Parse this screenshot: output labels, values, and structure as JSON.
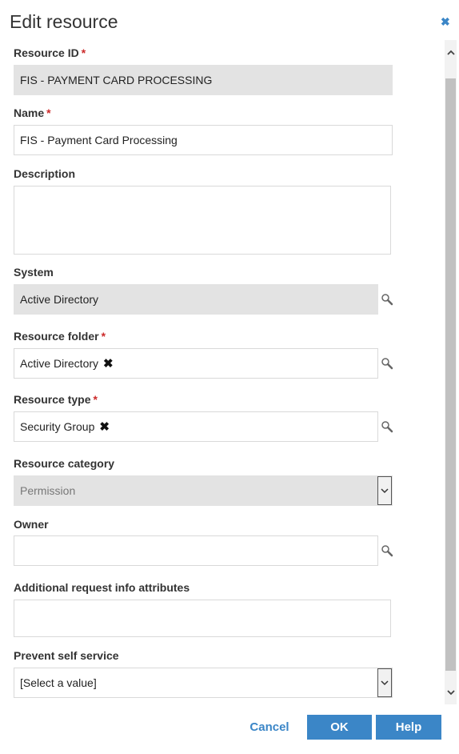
{
  "dialog": {
    "title": "Edit resource",
    "close_icon": "close-icon"
  },
  "fields": {
    "resource_id": {
      "label": "Resource ID",
      "required": "*",
      "value": "FIS - PAYMENT CARD PROCESSING"
    },
    "name": {
      "label": "Name",
      "required": "*",
      "value": "FIS - Payment Card Processing"
    },
    "description": {
      "label": "Description",
      "value": ""
    },
    "system": {
      "label": "System",
      "value": "Active Directory"
    },
    "resource_folder": {
      "label": "Resource folder",
      "required": "*",
      "value": "Active Directory"
    },
    "resource_type": {
      "label": "Resource type",
      "required": "*",
      "value": "Security Group"
    },
    "resource_category": {
      "label": "Resource category",
      "value": "Permission"
    },
    "owner": {
      "label": "Owner",
      "value": ""
    },
    "additional_info": {
      "label": "Additional request info attributes",
      "value": ""
    },
    "prevent_self_service": {
      "label": "Prevent self service",
      "value": "[Select a value]"
    }
  },
  "buttons": {
    "cancel": "Cancel",
    "ok": "OK",
    "help": "Help"
  },
  "colors": {
    "accent": "#3b86c7",
    "required": "#cc2b2b",
    "readonly_bg": "#e3e3e3"
  }
}
